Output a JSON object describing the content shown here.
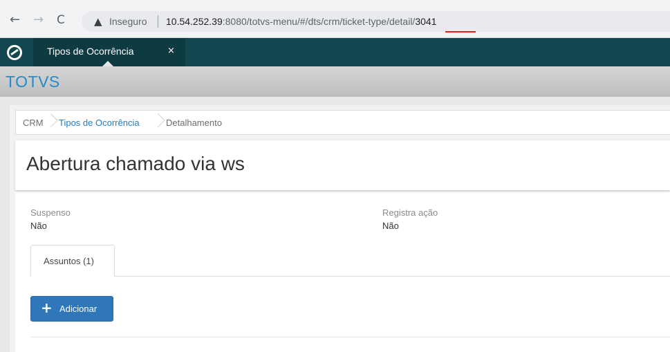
{
  "browser": {
    "insecure_label": "Inseguro",
    "url_host": "10.54.252.39",
    "url_path": ":8080/totvs-menu/#/dts/crm/ticket-type/detail/",
    "url_id": "3041"
  },
  "app_tabs": [
    {
      "label": "Tipos de Ocorrência",
      "close": "×"
    }
  ],
  "header": {
    "brand": "TOTVS"
  },
  "breadcrumb": {
    "items": [
      "CRM",
      "Tipos de Ocorrência",
      "Detalhamento"
    ]
  },
  "page": {
    "title": "Abertura chamado via ws"
  },
  "fields": [
    {
      "label": "Suspenso",
      "value": "Não"
    },
    {
      "label": "Registra ação",
      "value": "Não"
    }
  ],
  "detail_tabs": [
    {
      "label": "Assuntos (1)"
    }
  ],
  "actions": {
    "add_label": "Adicionar",
    "add_icon": "+"
  },
  "colors": {
    "tabbar": "#14464f",
    "brand": "#1f8ccf",
    "primary_button": "#2f77b9",
    "url_underline": "#e2231a"
  }
}
